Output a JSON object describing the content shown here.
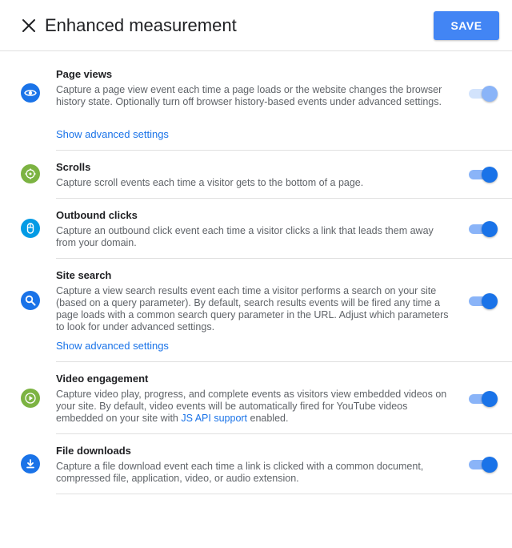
{
  "header": {
    "title": "Enhanced measurement",
    "save_label": "SAVE",
    "close_icon": "close-icon"
  },
  "colors": {
    "accent": "#1a73e8",
    "save_button": "#4285f4",
    "icon_blue": "#1a73e8",
    "icon_green": "#7cb342",
    "icon_cyan": "#039be5"
  },
  "settings": [
    {
      "title": "Page views",
      "description": "Capture a page view event each time a page loads or the website changes the browser history state. Optionally turn off browser history-based events under advanced settings.",
      "advanced_link": "Show advanced settings",
      "icon": "eye-icon",
      "enabled": true,
      "locked": true
    },
    {
      "title": "Scrolls",
      "description": "Capture scroll events each time a visitor gets to the bottom of a page.",
      "icon": "scroll-icon",
      "enabled": true
    },
    {
      "title": "Outbound clicks",
      "description": "Capture an outbound click event each time a visitor clicks a link that leads them away from your domain.",
      "icon": "mouse-icon",
      "enabled": true
    },
    {
      "title": "Site search",
      "description": "Capture a view search results event each time a visitor performs a search on your site (based on a query parameter). By default, search results events will be fired any time a page loads with a common search query parameter in the URL. Adjust which parameters to look for under advanced settings.",
      "advanced_link": "Show advanced settings",
      "icon": "search-icon",
      "enabled": true
    },
    {
      "title": "Video engagement",
      "description_before": "Capture video play, progress, and complete events as visitors view embedded videos on your site. By default, video events will be automatically fired for YouTube videos embedded on your site with ",
      "description_link": "JS API support",
      "description_after": " enabled.",
      "icon": "play-icon",
      "enabled": true
    },
    {
      "title": "File downloads",
      "description": "Capture a file download event each time a link is clicked with a common document, compressed file, application, video, or audio extension.",
      "icon": "download-icon",
      "enabled": true
    }
  ]
}
